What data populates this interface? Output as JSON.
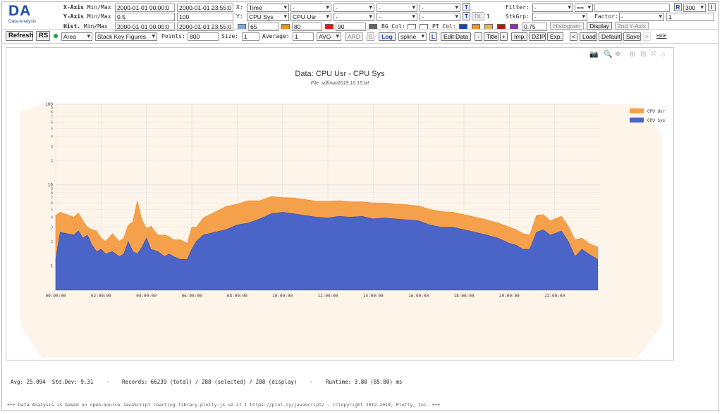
{
  "logo": {
    "text": "DA",
    "subtitle": "Data Analysis"
  },
  "xaxis": {
    "label": "X-Axis",
    "minmax_label": "Min/Max",
    "min": "2000-01-01 00:00:0",
    "max": "2000-01-01 23:55:0"
  },
  "yaxis": {
    "label": "Y-Axis",
    "minmax_label": "Min/Max",
    "min": "0.5",
    "max": "100"
  },
  "hist": {
    "label": "Hist.",
    "minmax_label": "Min/Max",
    "min": "2000-01-01 00:00:0",
    "max": "2000-01-01 23:55:0"
  },
  "x_select": {
    "label": "X:",
    "value": "Time",
    "extra": [
      "-",
      "-",
      "-",
      "-"
    ]
  },
  "y_select": {
    "label": "Y:",
    "value1": "CPU Sys",
    "value2": "CPU Usr",
    "extra": [
      "-",
      "-",
      "-"
    ]
  },
  "buttons": {
    "T": "T",
    "DL": "DL",
    "DL_value": "1",
    "R": "R",
    "info": "I",
    "refresh": "Refresh",
    "rs": "RS",
    "ard": "ARD",
    "s": "S",
    "log": "Log",
    "l": "L",
    "edit_data": "Edit Data",
    "minus": "-",
    "title": "Title",
    "plus": "+",
    "imp": "Imp.",
    "dzip": "DZIP",
    "exp": "Exp.",
    "lt": "<",
    "load": "Load",
    "default": "Default",
    "save": "Save",
    "gt": ">",
    "hide": "Hide",
    "histogram": "Histogram",
    "display": "Display",
    "second_y": "2nd Y-Axis"
  },
  "thresholds": {
    "c1": "#7da7e8",
    "v1": "65",
    "c2": "#f0951f",
    "v2": "80",
    "c3": "#e01b1b",
    "v3": "90",
    "c4": "#666666"
  },
  "bgcol": {
    "label": "BG Col:"
  },
  "ptcol": {
    "label": "PT Col:",
    "c1": "#1d3fbe",
    "c2": "#f0951f",
    "c3": "#f0b050",
    "c4": "#b01818",
    "c5": "#8a2bc2",
    "alpha": "0.75"
  },
  "filter": {
    "label": "Filter:",
    "value": "-",
    "op": "==",
    "text": ""
  },
  "stkgrp": {
    "label": "StkGrp:",
    "value": "-"
  },
  "factor": {
    "label": "Factor:",
    "value": "-",
    "text": "1"
  },
  "r_value": "300",
  "row4": {
    "type": "Area",
    "stack": "Stack Key Figures",
    "points_label": "Points:",
    "points": "800",
    "size_label": "Size:",
    "size": "1",
    "average_label": "Average:",
    "average": "1",
    "avg": "AVG",
    "line": "spline"
  },
  "chart_data": {
    "type": "area",
    "title": "Data: CPU Usr - CPU Sys",
    "subtitle": "File: sdfmon2019.10.15.txt",
    "xlabel": "",
    "ylabel": "",
    "y_scale": "log",
    "ylim": [
      0.5,
      100
    ],
    "x_ticks": [
      "00:00:00",
      "02:00:00",
      "04:00:00",
      "06:00:00",
      "08:00:00",
      "10:00:00",
      "12:00:00",
      "14:00:00",
      "16:00:00",
      "18:00:00",
      "20:00:00",
      "22:00:00"
    ],
    "y_tick_major": [
      "1",
      "10",
      "100"
    ],
    "y_tick_minor": [
      "2",
      "3",
      "4",
      "5",
      "6",
      "7",
      "8",
      "9"
    ],
    "legend_position": "top-right",
    "x_hours": [
      0,
      0.2,
      0.5,
      0.8,
      1.0,
      1.2,
      1.4,
      1.6,
      1.8,
      2.0,
      2.2,
      2.5,
      2.8,
      3.0,
      3.2,
      3.4,
      3.6,
      3.8,
      4.0,
      4.2,
      4.5,
      4.8,
      5.0,
      5.2,
      5.5,
      5.8,
      6.0,
      6.2,
      6.5,
      7.0,
      7.5,
      8.0,
      8.5,
      9.0,
      9.5,
      10.0,
      10.5,
      11.0,
      11.5,
      12.0,
      12.5,
      13.0,
      13.5,
      14.0,
      14.5,
      15.0,
      15.5,
      16.0,
      16.5,
      17.0,
      17.5,
      18.0,
      18.5,
      19.0,
      19.5,
      20.0,
      20.3,
      20.6,
      20.9,
      21.2,
      21.5,
      21.8,
      22.0,
      22.3,
      22.6,
      22.9,
      23.2,
      23.5,
      23.9
    ],
    "series": [
      {
        "name": "CPU Sys",
        "color": "#4a64c8",
        "values": [
          1.2,
          2.6,
          2.5,
          2.4,
          2.7,
          2.2,
          2.4,
          1.8,
          1.5,
          1.6,
          1.4,
          1.5,
          1.3,
          1.4,
          2.0,
          1.5,
          1.4,
          1.7,
          2.2,
          1.6,
          1.5,
          1.3,
          1.4,
          1.3,
          1.2,
          1.2,
          1.6,
          2.0,
          2.4,
          2.6,
          2.8,
          3.2,
          3.4,
          3.8,
          4.4,
          4.6,
          4.4,
          4.2,
          4.0,
          3.9,
          4.1,
          4.0,
          4.1,
          3.8,
          3.9,
          3.8,
          3.7,
          3.6,
          3.2,
          3.0,
          3.0,
          2.8,
          2.6,
          2.4,
          2.2,
          1.9,
          1.8,
          1.6,
          1.6,
          2.6,
          2.8,
          2.4,
          2.5,
          2.7,
          2.0,
          1.3,
          1.6,
          1.4,
          1.2
        ]
      },
      {
        "name": "CPU Usr",
        "color": "#f5a04a",
        "values": [
          3.0,
          2.0,
          1.8,
          1.6,
          1.8,
          1.4,
          0.6,
          1.0,
          1.2,
          0.6,
          0.6,
          1.0,
          0.7,
          0.8,
          1.2,
          2.0,
          5.0,
          2.0,
          0.7,
          1.5,
          0.9,
          1.1,
          0.9,
          0.8,
          0.9,
          0.7,
          1.4,
          1.0,
          1.5,
          2.0,
          2.6,
          2.6,
          3.0,
          2.6,
          2.8,
          2.4,
          2.5,
          2.4,
          2.3,
          2.4,
          2.3,
          2.2,
          2.1,
          2.2,
          2.1,
          2.0,
          2.0,
          1.9,
          1.8,
          1.7,
          1.6,
          1.5,
          1.4,
          1.3,
          1.2,
          1.1,
          1.0,
          0.9,
          0.8,
          1.6,
          1.5,
          1.2,
          1.3,
          1.4,
          1.1,
          0.8,
          0.6,
          0.5,
          0.5
        ]
      }
    ]
  },
  "status": {
    "text": "Avg: 25.094  Std.Dev: 9.31    -    Records: 66239 (total) / 288 (selected) / 288 (display)    -    Runtime: 3.80 (85.80) ms"
  },
  "credit": "+++ Data Analysis is based on open-source JavaScript charting library plotly.js v2.17.1 https://plot.ly/javascript/ - (C)opyright 2012-2019, Plotly, Inc. +++"
}
